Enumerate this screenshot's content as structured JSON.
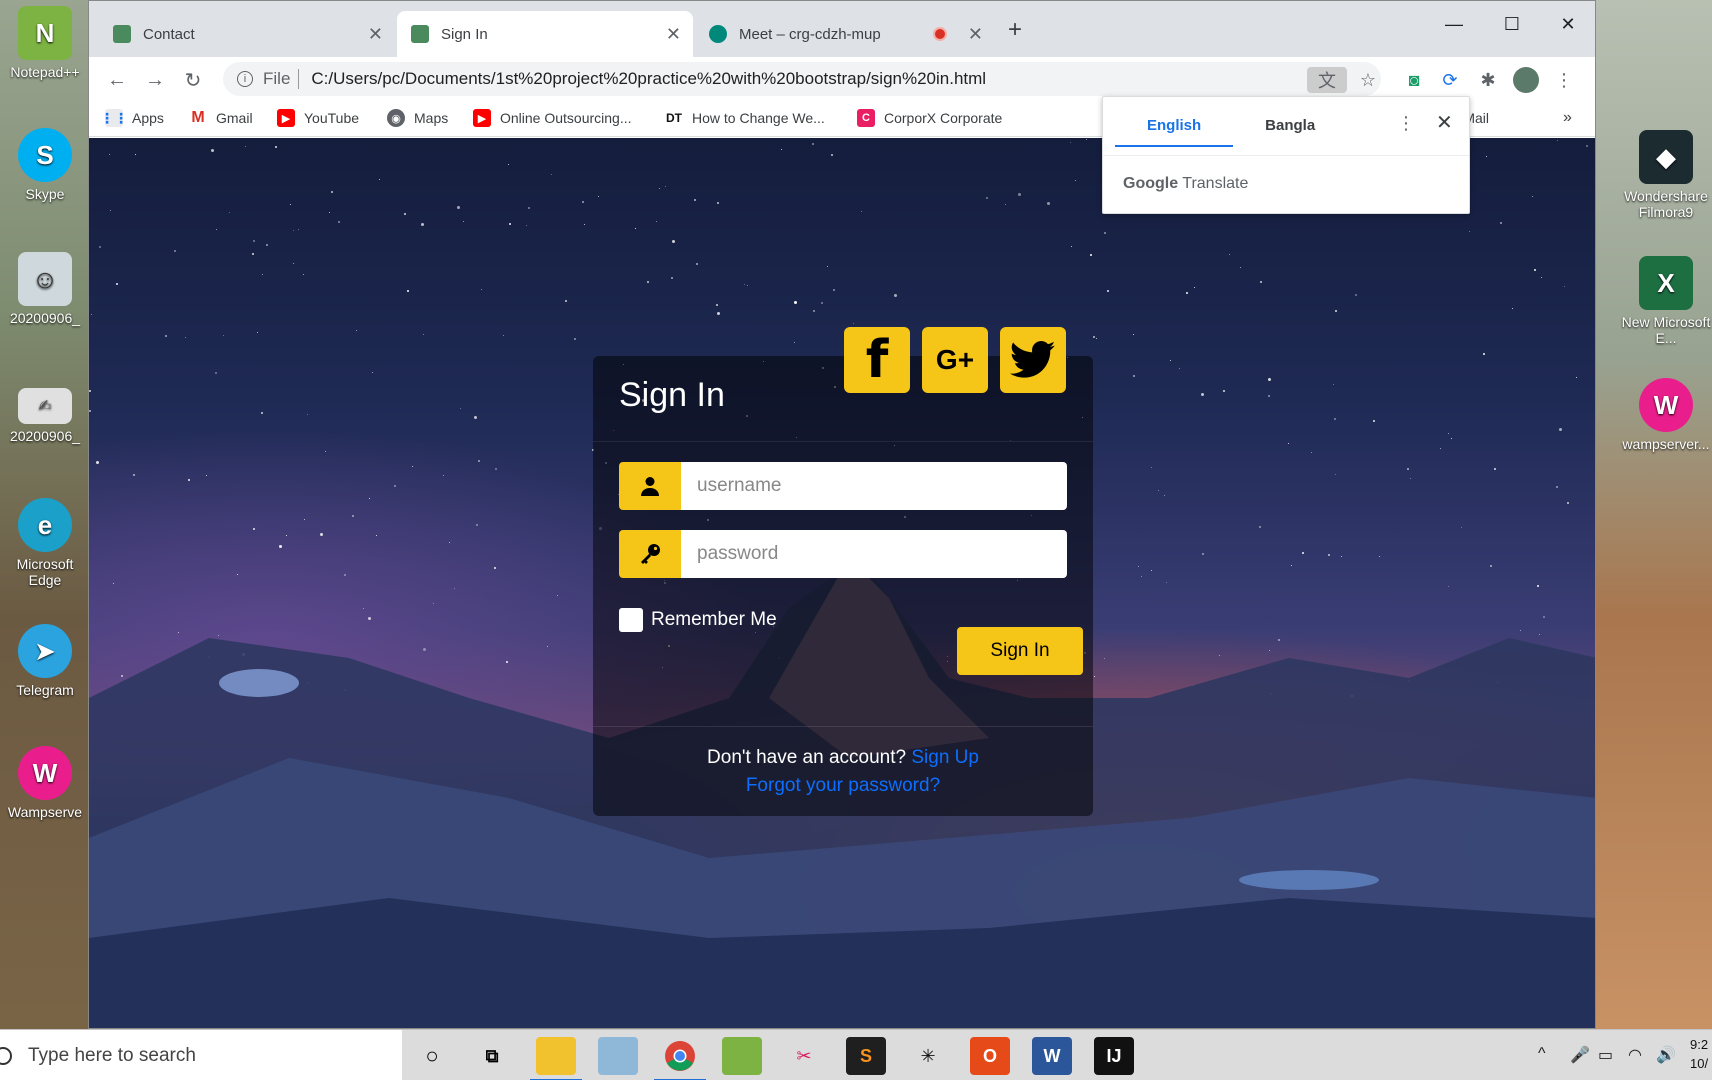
{
  "desktop": {
    "left_icons": [
      {
        "label": "Notepad++",
        "icon": "notepad-icon",
        "color": "#7cb342"
      },
      {
        "label": "Skype",
        "icon": "skype-icon",
        "color": "#00aff0"
      },
      {
        "label": "20200906_",
        "icon": "photo-icon",
        "color": "#cfd8dc"
      },
      {
        "label": "20200906_",
        "icon": "signature-icon",
        "color": "#e0e0e0"
      },
      {
        "label": "Microsoft Edge",
        "icon": "edge-icon",
        "color": "#1aa0c9"
      },
      {
        "label": "Telegram",
        "icon": "telegram-icon",
        "color": "#2aa3df"
      },
      {
        "label": "Wampserve",
        "icon": "wamp-icon",
        "color": "#e91e8c"
      }
    ],
    "right_icons": [
      {
        "label": "Wondershare Filmora9",
        "icon": "filmora-icon",
        "color": "#1b2b2f"
      },
      {
        "label": "New Microsoft E...",
        "icon": "excel-icon",
        "color": "#1d6f42"
      },
      {
        "label": "wampserver...",
        "icon": "wamp-icon",
        "color": "#e91e8c"
      }
    ]
  },
  "browser": {
    "tabs": [
      {
        "label": "Contact",
        "active": false
      },
      {
        "label": "Sign In",
        "active": true
      },
      {
        "label": "Meet – crg-cdzh-mup",
        "active": false
      }
    ],
    "address": {
      "scheme_label": "File",
      "url": "C:/Users/pc/Documents/1st%20project%20practice%20with%20bootstrap/sign%20in.html"
    },
    "bookmarks": [
      {
        "label": "Apps",
        "icon": "apps-icon"
      },
      {
        "label": "Gmail",
        "icon": "gmail-icon"
      },
      {
        "label": "YouTube",
        "icon": "youtube-icon"
      },
      {
        "label": "Maps",
        "icon": "maps-icon"
      },
      {
        "label": "Online Outsourcing...",
        "icon": "youtube-icon"
      },
      {
        "label": "How to Change We...",
        "icon": "dt-icon"
      },
      {
        "label": "CorporX Corporate",
        "icon": "corporx-icon"
      },
      {
        "label": "Yahoo Mail",
        "icon": "amazon-icon"
      }
    ],
    "bookmarks_overflow": "»"
  },
  "translate_popup": {
    "languages": [
      "English",
      "Bangla"
    ],
    "active_language": "English",
    "brand_google": "Google",
    "brand_translate": "Translate"
  },
  "signin": {
    "title": "Sign In",
    "social": [
      {
        "label": "f",
        "icon": "facebook-icon"
      },
      {
        "label": "G+",
        "icon": "google-plus-icon"
      },
      {
        "label": "",
        "icon": "twitter-icon"
      }
    ],
    "username_placeholder": "username",
    "password_placeholder": "password",
    "remember_label": "Remember Me",
    "button_label": "Sign In",
    "no_account_text": "Don't have an account?",
    "signup_link": "Sign Up",
    "forgot_link": "Forgot your password?"
  },
  "taskbar": {
    "search_placeholder": "Type here to search",
    "clock_line1": "9:2",
    "clock_line2": "10/"
  },
  "colors": {
    "accent_yellow": "#f5c518",
    "link_blue": "#0d6efd",
    "chrome_blue": "#1a73e8"
  }
}
